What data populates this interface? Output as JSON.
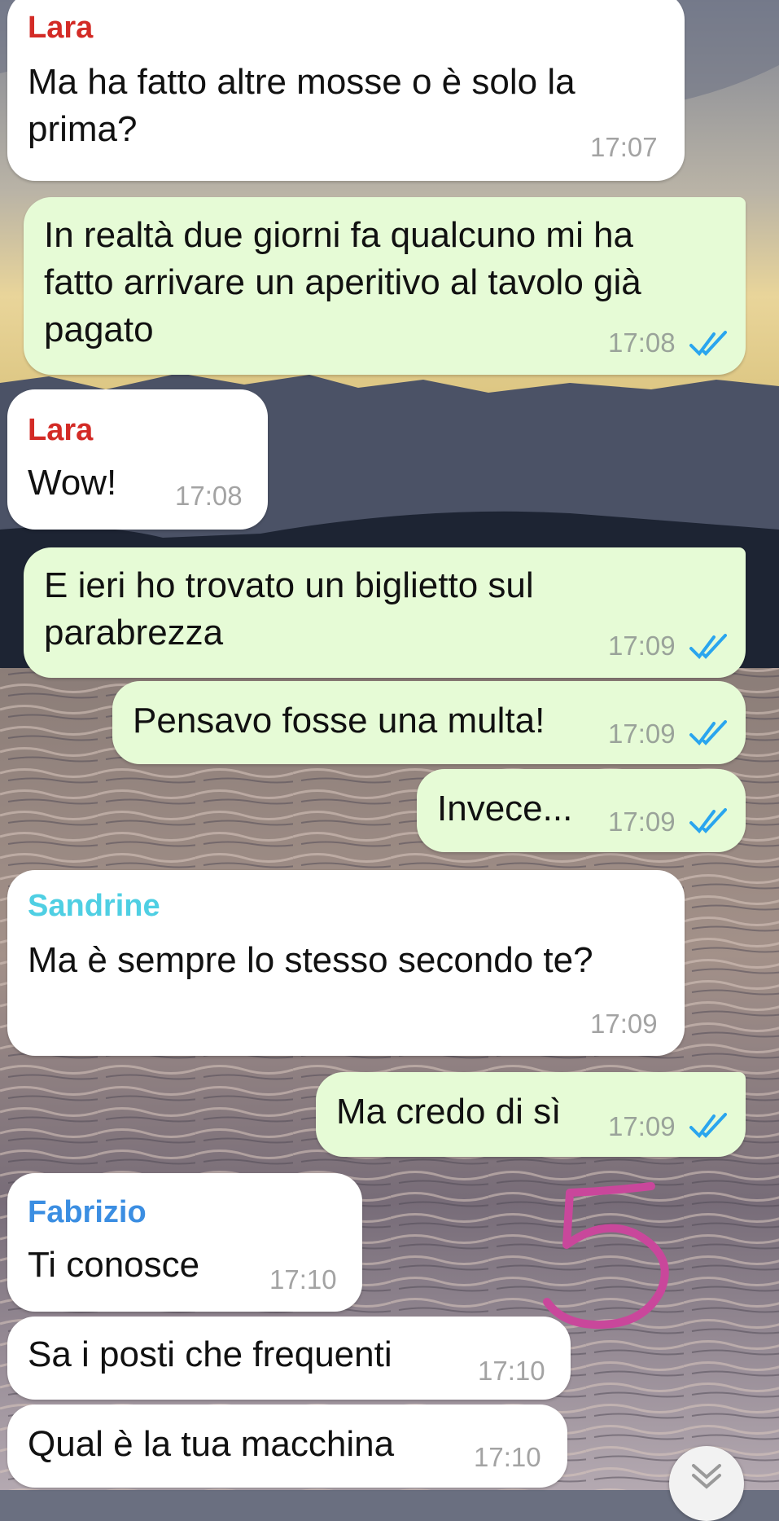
{
  "colors": {
    "incoming_bubble": "#ffffff",
    "outgoing_bubble": "#e6fbd6",
    "sender_lara": "#d32b26",
    "sender_sandrine": "#4fcfe3",
    "sender_fabrizio": "#3b8ee2",
    "read_ticks": "#2aa5ee",
    "annotation_ink": "#c9479b"
  },
  "messages": [
    {
      "sender": "Lara",
      "lines": [
        "Ma ha fatto altre mosse o è solo la",
        "prima?"
      ],
      "time": "17:07"
    },
    {
      "lines": [
        "In realtà due giorni fa qualcuno mi ha",
        "fatto arrivare un aperitivo al tavolo già",
        "pagato"
      ],
      "time": "17:08",
      "status": "read"
    },
    {
      "sender": "Lara",
      "lines": [
        "Wow!"
      ],
      "time": "17:08"
    },
    {
      "lines": [
        "E ieri ho trovato un biglietto sul",
        "parabrezza"
      ],
      "time": "17:09",
      "status": "read"
    },
    {
      "lines": [
        "Pensavo fosse una multa!"
      ],
      "time": "17:09",
      "status": "read"
    },
    {
      "lines": [
        "Invece..."
      ],
      "time": "17:09",
      "status": "read"
    },
    {
      "sender": "Sandrine",
      "lines": [
        "Ma è sempre lo stesso secondo te?"
      ],
      "time": "17:09"
    },
    {
      "lines": [
        "Ma credo di sì"
      ],
      "time": "17:09",
      "status": "read"
    },
    {
      "sender": "Fabrizio",
      "lines": [
        "Ti conosce"
      ],
      "time": "17:10"
    },
    {
      "lines": [
        "Sa i posti che frequenti"
      ],
      "time": "17:10"
    },
    {
      "lines": [
        "Qual è la tua macchina"
      ],
      "time": "17:10"
    }
  ],
  "annotation": {
    "text": "5",
    "icon": "handwritten-number"
  },
  "scroll_button": {
    "icon": "double-chevron-down-icon"
  }
}
